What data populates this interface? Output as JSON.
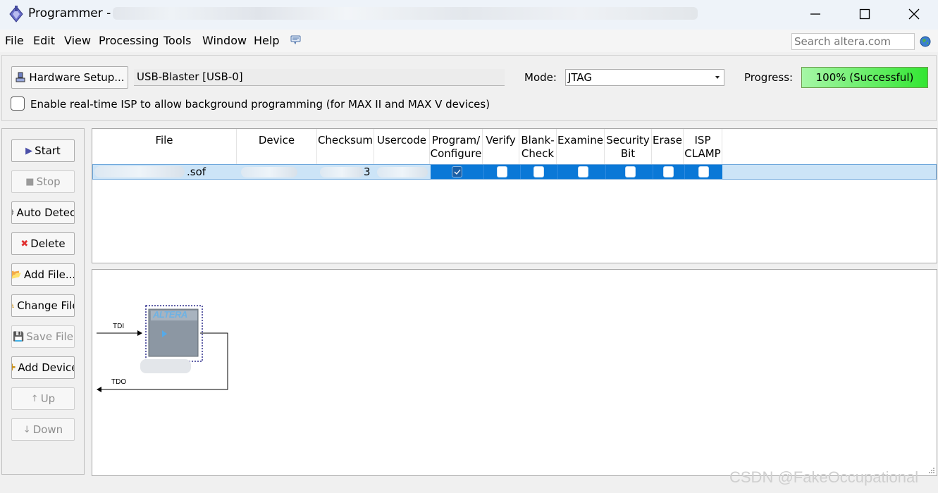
{
  "window": {
    "title": "Programmer -"
  },
  "menu": {
    "items": [
      "File",
      "Edit",
      "View",
      "Processing",
      "Tools",
      "Window",
      "Help"
    ],
    "search_placeholder": "Search altera.com"
  },
  "hardware": {
    "setup_label": "Hardware Setup...",
    "device": "USB-Blaster [USB-0]",
    "mode_label": "Mode:",
    "mode_value": "JTAG",
    "progress_label": "Progress:",
    "progress_text": "100% (Successful)",
    "progress_fraction": 1.0,
    "isp_label": "Enable real-time ISP to allow background programming (for MAX II and MAX V devices)",
    "isp_checked": false
  },
  "sidebar": {
    "buttons": [
      {
        "label": "Start",
        "icon": "start-icon",
        "enabled": true
      },
      {
        "label": "Stop",
        "icon": "stop-icon",
        "enabled": false
      },
      {
        "label": "Auto Detect",
        "icon": "auto-detect-icon",
        "enabled": true
      },
      {
        "label": "Delete",
        "icon": "delete-icon",
        "enabled": true
      },
      {
        "label": "Add File...",
        "icon": "add-file-icon",
        "enabled": true
      },
      {
        "label": "Change File",
        "icon": "change-file-icon",
        "enabled": true
      },
      {
        "label": "Save File",
        "icon": "save-file-icon",
        "enabled": false
      },
      {
        "label": "Add Device",
        "icon": "add-device-icon",
        "enabled": true
      },
      {
        "label": "Up",
        "icon": "up-icon",
        "enabled": false
      },
      {
        "label": "Down",
        "icon": "down-icon",
        "enabled": false
      }
    ]
  },
  "table": {
    "columns": [
      "File",
      "Device",
      "Checksum",
      "Usercode",
      "Program/\nConfigure",
      "Verify",
      "Blank-\nCheck",
      "Examine",
      "Security\nBit",
      "Erase",
      "ISP\nCLAMP"
    ],
    "rows": [
      {
        "file": ".sof",
        "checksum_partial": "3",
        "program_configure": true,
        "verify": false,
        "blank_check": false,
        "examine": false,
        "security_bit": false,
        "erase": false,
        "isp_clamp": false
      }
    ]
  },
  "chain": {
    "tdi_label": "TDI",
    "tdo_label": "TDO",
    "chip_brand": "ALTERA"
  },
  "watermark": "CSDN @FakeOccupational",
  "colors": {
    "selection": "#0a78d7",
    "row_highlight": "#cce4f7",
    "progress_fill": "#33e633"
  }
}
